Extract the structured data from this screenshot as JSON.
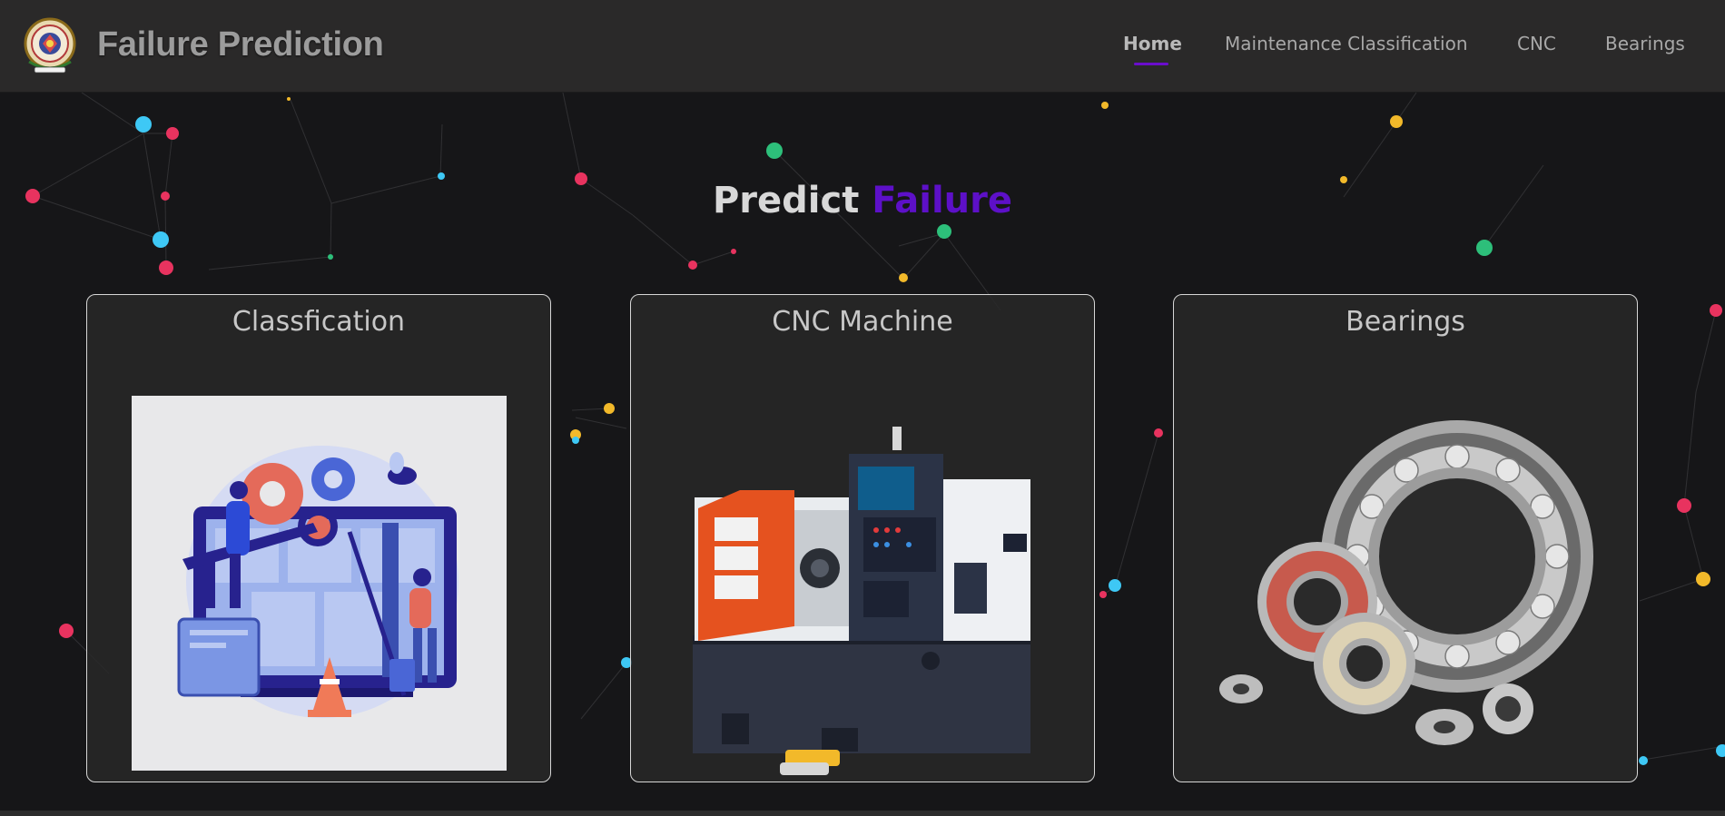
{
  "header": {
    "title": "Failure Prediction",
    "logo_icon": "college-emblem-icon",
    "nav": [
      {
        "label": "Home",
        "active": true
      },
      {
        "label": "Maintenance Classification",
        "active": false
      },
      {
        "label": "CNC",
        "active": false
      },
      {
        "label": "Bearings",
        "active": false
      }
    ]
  },
  "hero": {
    "title_part1": "Predict",
    "title_part2": "Failure"
  },
  "cards": [
    {
      "title": "Classfication",
      "image": "maintenance-illustration"
    },
    {
      "title": "CNC Machine",
      "image": "cnc-lathe-machine"
    },
    {
      "title": "Bearings",
      "image": "ball-bearings"
    }
  ],
  "colors": {
    "accent": "#5d10c8",
    "header_bg": "#2a2929",
    "page_bg": "#161618",
    "card_border": "#d6d6d6"
  }
}
